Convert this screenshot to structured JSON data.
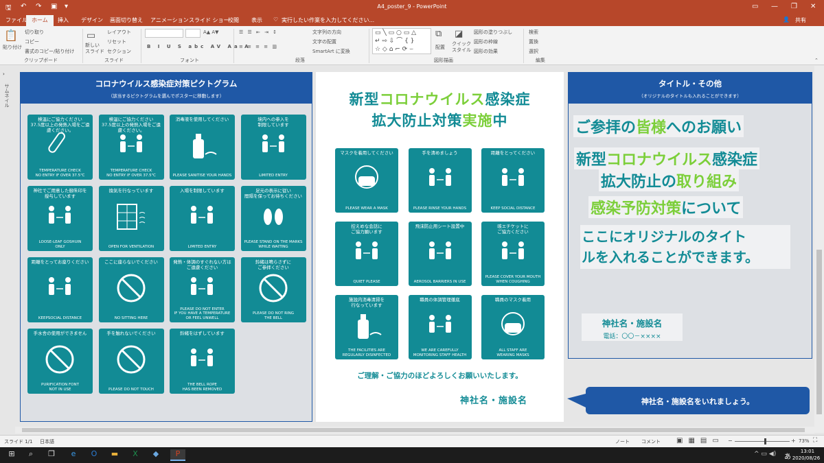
{
  "titlebar": {
    "title": "A4_poster_9 - PowerPoint",
    "icons": [
      "save-icon",
      "undo-icon",
      "redo-icon",
      "present-icon",
      "qat-more-icon"
    ],
    "window_controls": [
      "minimize-icon",
      "restore-icon",
      "close-icon"
    ]
  },
  "tabs": [
    "ファイル",
    "ホーム",
    "挿入",
    "デザイン",
    "画面切り替え",
    "アニメーション",
    "スライド ショー",
    "校閲",
    "表示"
  ],
  "active_tab": "ホーム",
  "tell_me": "実行したい作業を入力してください...",
  "user": "サインイン",
  "share": "共有",
  "ribbon": {
    "clipboard": {
      "paste": "貼り付け",
      "cut": "切り取り",
      "copy": "コピー",
      "format_painter": "書式のコピー/貼り付け",
      "group": "クリップボード"
    },
    "slides": {
      "new_slide": "新しい\nスライド",
      "layout": "レイアウト",
      "reset": "リセット",
      "section": "セクション",
      "group": "スライド"
    },
    "font": {
      "group": "フォント",
      "buttons": [
        "B",
        "I",
        "U",
        "S",
        "abc",
        "AV",
        "Aa",
        "A"
      ]
    },
    "paragraph": {
      "group": "段落",
      "text_direction": "文字列の方向",
      "align_text": "文字の配置",
      "smartart": "SmartArt に変換"
    },
    "drawing": {
      "group": "図形描画",
      "arrange": "配置",
      "quick_styles": "クイック\nスタイル",
      "fill": "図形の塗りつぶし",
      "outline": "図形の枠線",
      "effects": "図形の効果"
    },
    "editing": {
      "group": "編集",
      "find": "検索",
      "replace": "置換",
      "select": "選択"
    }
  },
  "thumb_label": "サムネイル",
  "left_panel": {
    "title": "コロナウイルス感染症対策ピクトグラム",
    "subtitle": "（該当するピクトグラムを選んでポスターに移動します）",
    "tiles": [
      {
        "top": "検温にご協力ください\n37.5度以上の発熱入場をご遠慮ください。",
        "bottom": "TEMPERATURE CHECK\nNO ENTRY IF OVER 37.5℃",
        "icon": "thermometer-icon"
      },
      {
        "top": "検温にご協力ください\n37.5度以上の発熱入場をご遠慮ください。",
        "bottom": "TEMPERATURE CHECK\nNO ENTRY IF OVER 37.5℃",
        "icon": "temperature-gun-icon"
      },
      {
        "top": "消毒液を使用してください",
        "bottom": "PLEASE SANITISE YOUR HANDS",
        "icon": "sanitizer-icon"
      },
      {
        "top": "境内への参入を\n制限しています",
        "bottom": "LIMITED ENTRY",
        "icon": "shrine-entry-icon"
      },
      {
        "top": "神社でご用意した御朱印を\n授与しています",
        "bottom": "LOOSE-LEAF GOSHUIN\nONLY",
        "icon": "goshuin-icon"
      },
      {
        "top": "換気を行なっています",
        "bottom": "OPEN FOR VENTILATION",
        "icon": "ventilation-icon"
      },
      {
        "top": "入場を制限しています",
        "bottom": "LIMITED ENTRY",
        "icon": "limited-entry-icon"
      },
      {
        "top": "足元の表示に従い\n間隔を保ってお待ちください",
        "bottom": "PLEASE STAND ON THE MARKS\nWHILE WAITING",
        "icon": "footprints-icon"
      },
      {
        "top": "距離をとってお座りください",
        "bottom": "KEEPSOCIAL DISTANCE",
        "icon": "seated-distance-icon"
      },
      {
        "top": "ここに座らないでください",
        "bottom": "NO SITTING HERE",
        "icon": "no-sitting-icon"
      },
      {
        "top": "発熱・体調のすぐれない方は\nご遠慮ください",
        "bottom": "PLEASE DO NOT ENTER\nIF YOU HAVE A TEMPERATURE\nOR FEEL UNWELL",
        "icon": "unwell-icon"
      },
      {
        "top": "鈴緒は鳴らさずに\nご参拝ください",
        "bottom": "PLEASE DO NOT RING\nTHE BELL",
        "icon": "no-bell-icon"
      },
      {
        "top": "手水舎の使用ができません",
        "bottom": "PURIFICATION FONT\nNOT IN USE",
        "icon": "no-font-icon"
      },
      {
        "top": "手を触れないでください",
        "bottom": "PLEASE DO NOT TOUCH",
        "icon": "no-touch-icon"
      },
      {
        "top": "鈴緒をはずしています",
        "bottom": "THE BELL ROPE\nHAS BEEN REMOVED",
        "icon": "bell-rope-icon"
      }
    ]
  },
  "poster": {
    "title_line1": [
      {
        "t": "新型",
        "c": "#128b95"
      },
      {
        "t": "コロナウイルス",
        "c": "#7ccf3a"
      },
      {
        "t": "感染症",
        "c": "#128b95"
      }
    ],
    "title_line2": [
      {
        "t": "拡大防止対策",
        "c": "#128b95"
      },
      {
        "t": "実施",
        "c": "#7ccf3a"
      },
      {
        "t": "中",
        "c": "#128b95"
      }
    ],
    "tiles": [
      {
        "top": "マスクを着用してください",
        "bottom": "PLEASE WEAR A MASK",
        "icon": "mask-icon"
      },
      {
        "top": "手を清めましょう",
        "bottom": "PLEASE RINSE YOUR HANDS",
        "icon": "rinse-hands-icon"
      },
      {
        "top": "距離をとってください",
        "bottom": "KEEP SOCIAL DISTANCE",
        "icon": "social-distance-icon"
      },
      {
        "top": "控えめな会話に\nご協力願います",
        "bottom": "QUIET PLEASE",
        "icon": "quiet-icon"
      },
      {
        "top": "飛沫防止用シート設置中",
        "bottom": "AEROSOL BARRIERS IN USE",
        "icon": "barrier-icon"
      },
      {
        "top": "咳エチケットに\nご協力ください",
        "bottom": "PLEASE COVER YOUR MOUTH\nWHEN COUGHING",
        "icon": "cough-icon"
      },
      {
        "top": "施設内消毒清掃を\n行なっています",
        "bottom": "THE FACILITIES ARE\nREGULARLY DISINFECTED",
        "icon": "spray-icon"
      },
      {
        "top": "職員の体調管理徹底",
        "bottom": "WE ARE CAREFULLY\nMONITORING STAFF HEALTH",
        "icon": "staff-health-icon"
      },
      {
        "top": "職員のマスク着用",
        "bottom": "ALL STAFF ARE\nWEARING MASKS",
        "icon": "staff-mask-icon"
      }
    ],
    "thanks": "ご理解・ご協力のほどよろしくお願いいたします。",
    "shrine_name": "神社名・施設名"
  },
  "right_panel": {
    "title": "タイトル・その他",
    "subtitle": "（オリジナルのタイトルも入れることができます）",
    "line1": [
      {
        "t": "ご参拝の",
        "c": "#128b95"
      },
      {
        "t": "皆様",
        "c": "#7ccf3a"
      },
      {
        "t": "への",
        "c": "#128b95"
      },
      {
        "t": "お願い",
        "c": "#128b95"
      }
    ],
    "line2": [
      {
        "t": "新型",
        "c": "#128b95"
      },
      {
        "t": "コロナウイルス",
        "c": "#7ccf3a"
      },
      {
        "t": "感染症",
        "c": "#128b95"
      }
    ],
    "line3": [
      {
        "t": "拡大防止の",
        "c": "#128b95"
      },
      {
        "t": "取り組み",
        "c": "#7ccf3a"
      }
    ],
    "line4": [
      {
        "t": "感染予防対策",
        "c": "#7ccf3a"
      },
      {
        "t": "について",
        "c": "#128b95"
      }
    ],
    "orig1": "ここにオリジナルのタイ",
    "orig1b": "ト",
    "orig2": "ルを入れることができます。",
    "name": "神社名・施設名",
    "tel": "電話：〇〇－××××"
  },
  "callout": "神社名・施設名をいれましょう。",
  "status": {
    "slide": "スライド 1/1",
    "lang": "日本語",
    "notes": "ノート",
    "comments": "コメント",
    "zoom": "73%",
    "zoom_level": 0.73
  },
  "taskbar": {
    "time": "13:01",
    "date": "2020/08/26",
    "ime": "あ"
  },
  "colors": {
    "accent": "#b7472a",
    "teal": "#128b95",
    "green": "#7ccf3a",
    "blue": "#1f58a6"
  }
}
